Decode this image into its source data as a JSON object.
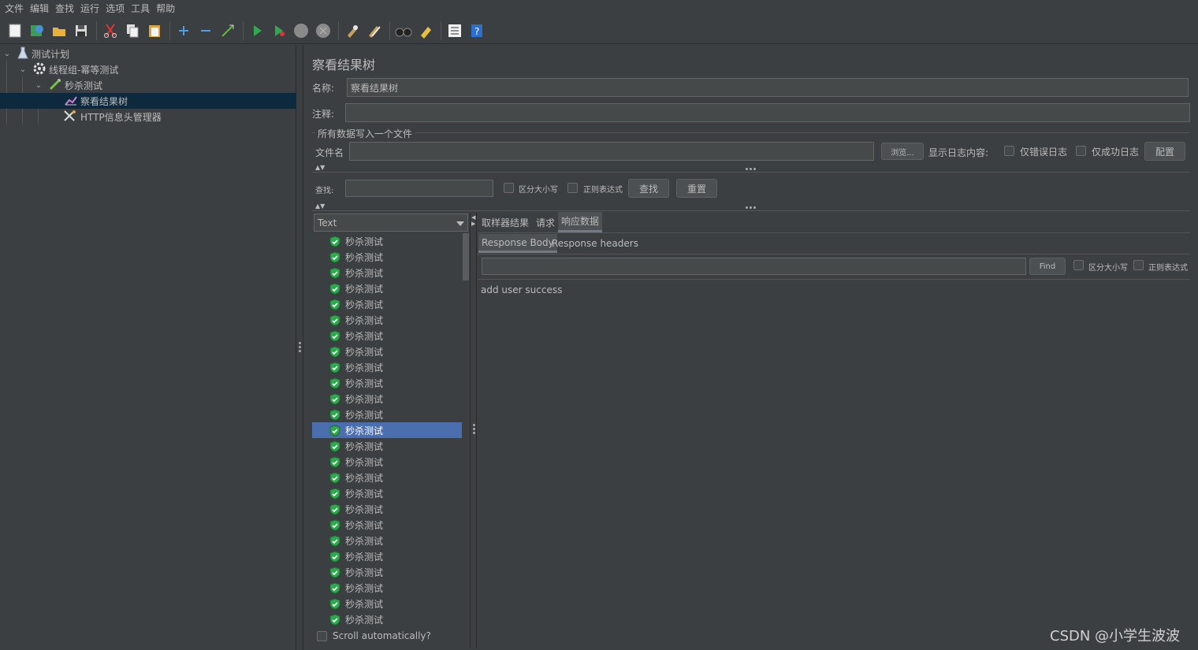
{
  "menu": [
    "文件",
    "编辑",
    "查找",
    "运行",
    "选项",
    "工具",
    "帮助"
  ],
  "toolbar_icons": [
    "new-icon",
    "templates-icon",
    "open-icon",
    "save-icon",
    "cut-icon",
    "copy-icon",
    "paste-icon",
    "expand-icon",
    "collapse-icon",
    "toggle-icon",
    "start-icon",
    "start-no-pause-icon",
    "stop-icon",
    "shutdown-icon",
    "clear-icon",
    "clear-all-icon",
    "search-icon",
    "reset-search-icon",
    "function-helper-icon",
    "help-icon"
  ],
  "tree": {
    "items": [
      {
        "label": "测试计划",
        "icon": "test-plan-icon"
      },
      {
        "label": "线程组-幂等测试",
        "icon": "thread-group-icon"
      },
      {
        "label": "秒杀测试",
        "icon": "http-sampler-icon"
      },
      {
        "label": "察看结果树",
        "icon": "view-results-icon"
      },
      {
        "label": "HTTP信息头管理器",
        "icon": "header-manager-icon"
      }
    ]
  },
  "panel": {
    "title": "察看结果树",
    "name_label": "名称:",
    "name_value": "察看结果树",
    "comment_label": "注释:",
    "comment_value": "",
    "file_section": "所有数据写入一个文件",
    "filename_label": "文件名",
    "filename_value": "",
    "browse_button": "浏览...",
    "log_label": "显示日志内容:",
    "errors_only": "仅错误日志",
    "success_only": "仅成功日志",
    "configure_button": "配置"
  },
  "search": {
    "label": "查找:",
    "value": "",
    "case_sensitive": "区分大小写",
    "regex": "正则表达式",
    "find_button": "查找",
    "reset_button": "重置"
  },
  "renderer": {
    "selected": "Text"
  },
  "results": {
    "items": [
      "秒杀测试",
      "秒杀测试",
      "秒杀测试",
      "秒杀测试",
      "秒杀测试",
      "秒杀测试",
      "秒杀测试",
      "秒杀测试",
      "秒杀测试",
      "秒杀测试",
      "秒杀测试",
      "秒杀测试",
      "秒杀测试",
      "秒杀测试",
      "秒杀测试",
      "秒杀测试",
      "秒杀测试",
      "秒杀测试",
      "秒杀测试",
      "秒杀测试",
      "秒杀测试",
      "秒杀测试",
      "秒杀测试",
      "秒杀测试",
      "秒杀测试"
    ],
    "selected_index": 12,
    "scroll_auto": "Scroll automatically?"
  },
  "detail_tabs": [
    "取样器结果",
    "请求",
    "响应数据"
  ],
  "detail_active": 2,
  "response_tabs": [
    "Response Body",
    "Response headers"
  ],
  "response_find_button": "Find",
  "response_case": "区分大小写",
  "response_regex": "正则表达式",
  "response_body": "add user success",
  "watermark": "CSDN @小学生波波"
}
